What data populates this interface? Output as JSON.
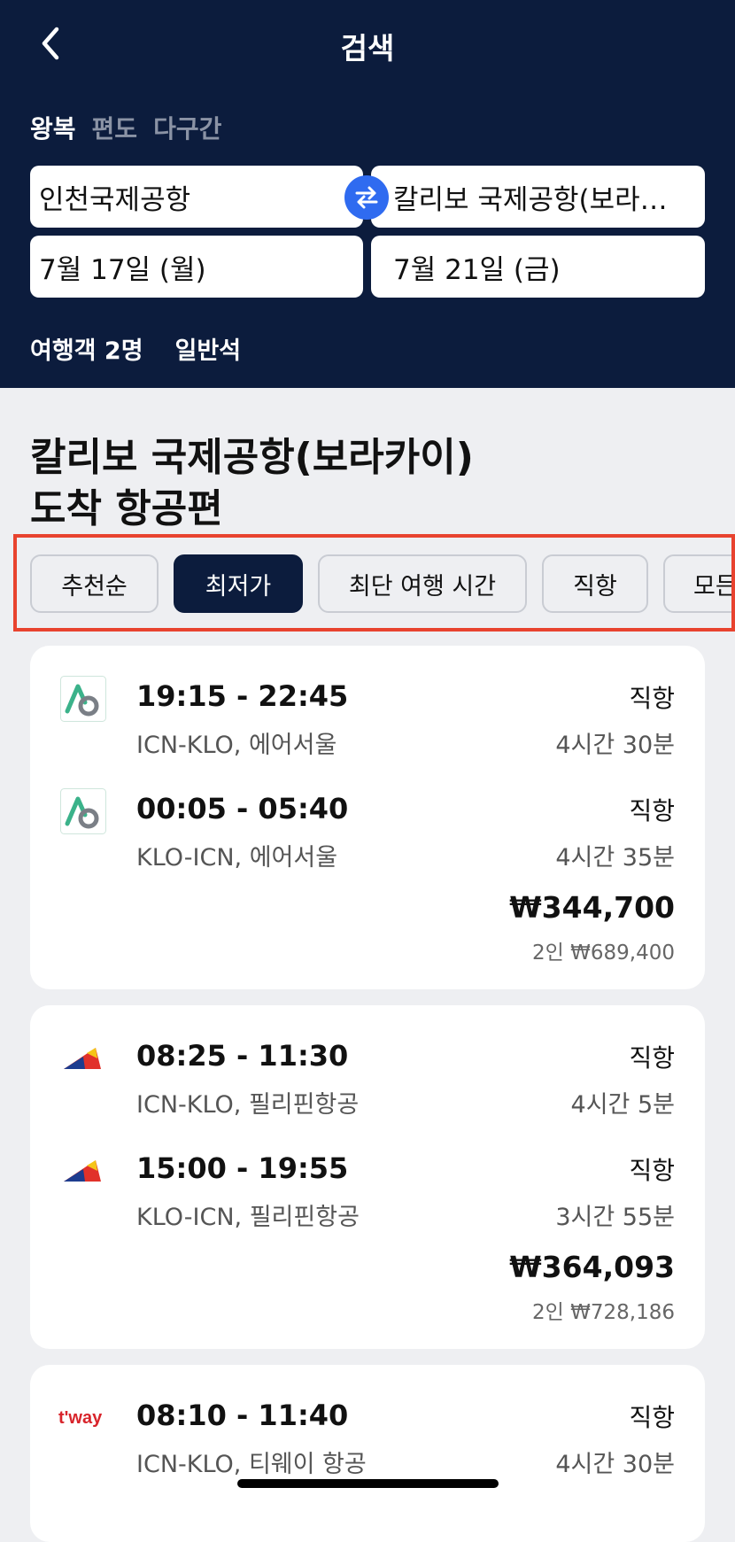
{
  "header": {
    "title": "검색",
    "trip_tabs": [
      "왕복",
      "편도",
      "다구간"
    ],
    "origin": "인천국제공항",
    "destination": "칼리보 국제공항(보라…",
    "depart_date": "7월 17일 (월)",
    "return_date": "7월 21일 (금)",
    "travelers": "여행객 2명",
    "cabin": "일반석"
  },
  "results": {
    "title_line1": "칼리보 국제공항(보라카이)",
    "title_line2": "도착 항공편"
  },
  "filters": [
    "추천순",
    "최저가",
    "최단 여행 시간",
    "직항",
    "모든"
  ],
  "flights": [
    {
      "airline_icon": "air-seoul-logo",
      "legs": [
        {
          "time": "19:15 - 22:45",
          "route": "ICN-KLO, 에어서울",
          "type": "직항",
          "duration": "4시간 30분"
        },
        {
          "time": "00:05 - 05:40",
          "route": "KLO-ICN, 에어서울",
          "type": "직항",
          "duration": "4시간 35분"
        }
      ],
      "price": "₩344,700",
      "total": "2인 ₩689,400"
    },
    {
      "airline_icon": "philippine-airlines-logo",
      "legs": [
        {
          "time": "08:25 - 11:30",
          "route": "ICN-KLO, 필리핀항공",
          "type": "직항",
          "duration": "4시간 5분"
        },
        {
          "time": "15:00 - 19:55",
          "route": "KLO-ICN, 필리핀항공",
          "type": "직항",
          "duration": "3시간 55분"
        }
      ],
      "price": "₩364,093",
      "total": "2인 ₩728,186"
    },
    {
      "airline_icon": "tway-logo",
      "legs": [
        {
          "time": "08:10 - 11:40",
          "route": "ICN-KLO, 티웨이 항공",
          "type": "직항",
          "duration": "4시간 30분"
        }
      ]
    }
  ],
  "tway_logo_text": "t'way",
  "colors": {
    "header_bg": "#0c1c3d",
    "accent": "#2f6bf0",
    "highlight": "#e8432f"
  }
}
